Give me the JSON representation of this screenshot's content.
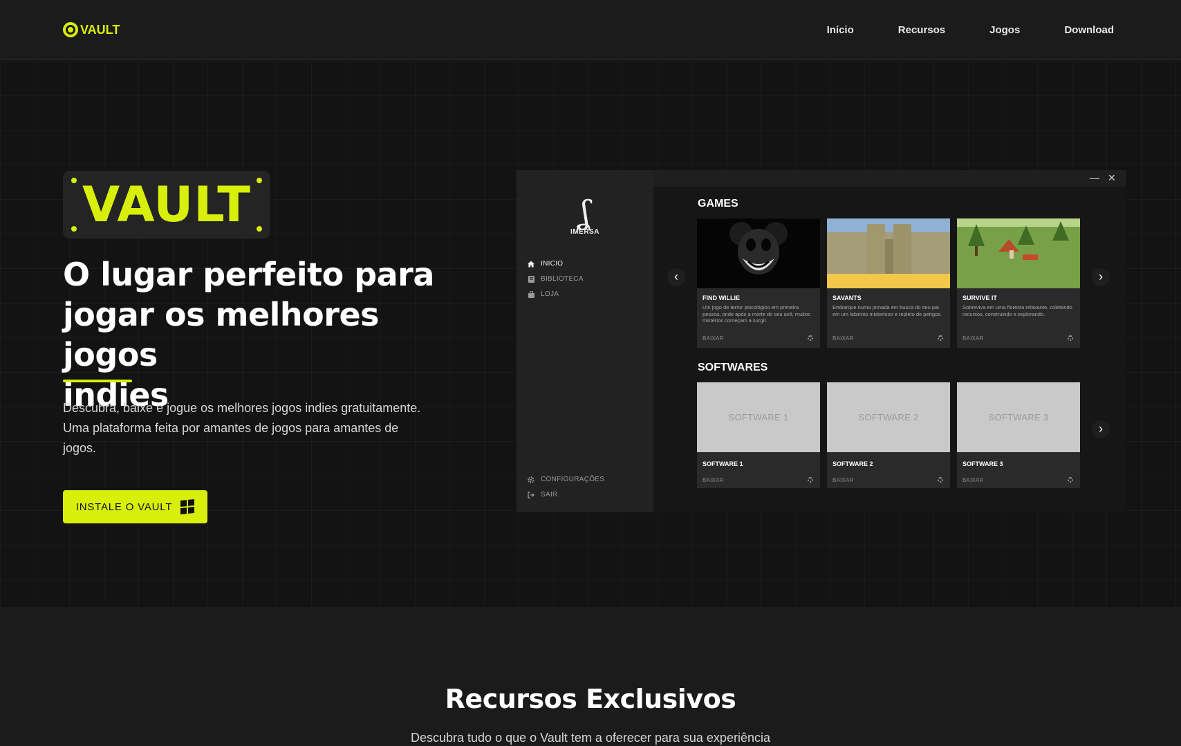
{
  "nav": {
    "logo_text": "VAULT",
    "links": [
      "Início",
      "Recursos",
      "Jogos",
      "Download"
    ]
  },
  "hero": {
    "logo_text": "VAULT",
    "title_lines": [
      "O lugar perfeito para",
      "jogar os melhores jogos",
      "indies"
    ],
    "description_lines": [
      "Descubra, baixe e jogue os melhores jogos indies gratuitamente.",
      "Uma plataforma feita por amantes de jogos para amantes de",
      "jogos."
    ],
    "cta_label": "INSTALE O VAULT"
  },
  "app": {
    "window_controls": {
      "minimize": "—",
      "close": "✕"
    },
    "brand": {
      "glyph": "ʆ",
      "name": "IMERSA"
    },
    "sidebar": {
      "items": [
        {
          "label": "INICIO",
          "icon": "home-icon"
        },
        {
          "label": "BIBLIOTECA",
          "icon": "library-icon"
        },
        {
          "label": "LOJA",
          "icon": "bag-icon"
        }
      ],
      "bottom": [
        {
          "label": "CONFIGURAÇÕES",
          "icon": "gear-icon"
        },
        {
          "label": "SAIR",
          "icon": "logout-icon"
        }
      ]
    },
    "games_title": "GAMES",
    "games": [
      {
        "title": "FIND WILLIE",
        "description": "Um jogo de terror psicológico em primeira pessoa, onde após a morte do seu avô, muitos mistérios começam a surgir.",
        "button": "BAIXAR"
      },
      {
        "title": "SAVANTS",
        "description": "Embarque numa jornada em busca do seu pai em um labirinto misterioso e repleto de perigos.",
        "button": "BAIXAR"
      },
      {
        "title": "SURVIVE IT",
        "description": "Sobreviva em uma floresta relaxante, coletando recursos, construindo e explorando.",
        "button": "BAIXAR"
      }
    ],
    "softwares_title": "SOFTWARES",
    "softwares": [
      {
        "thumb_label": "SOFTWARE 1",
        "title": "SOFTWARE 1",
        "button": "BAIXAR"
      },
      {
        "thumb_label": "SOFTWARE 2",
        "title": "SOFTWARE 2",
        "button": "BAIXAR"
      },
      {
        "thumb_label": "SOFTWARE 3",
        "title": "SOFTWARE 3",
        "button": "BAIXAR"
      }
    ],
    "arrows": {
      "prev": "‹",
      "next": "›"
    }
  },
  "features": {
    "title": "Recursos Exclusivos",
    "subtitle": "Descubra tudo o que o Vault tem a oferecer para sua experiência"
  },
  "colors": {
    "accent": "#d7ef0a",
    "background": "#141414"
  }
}
